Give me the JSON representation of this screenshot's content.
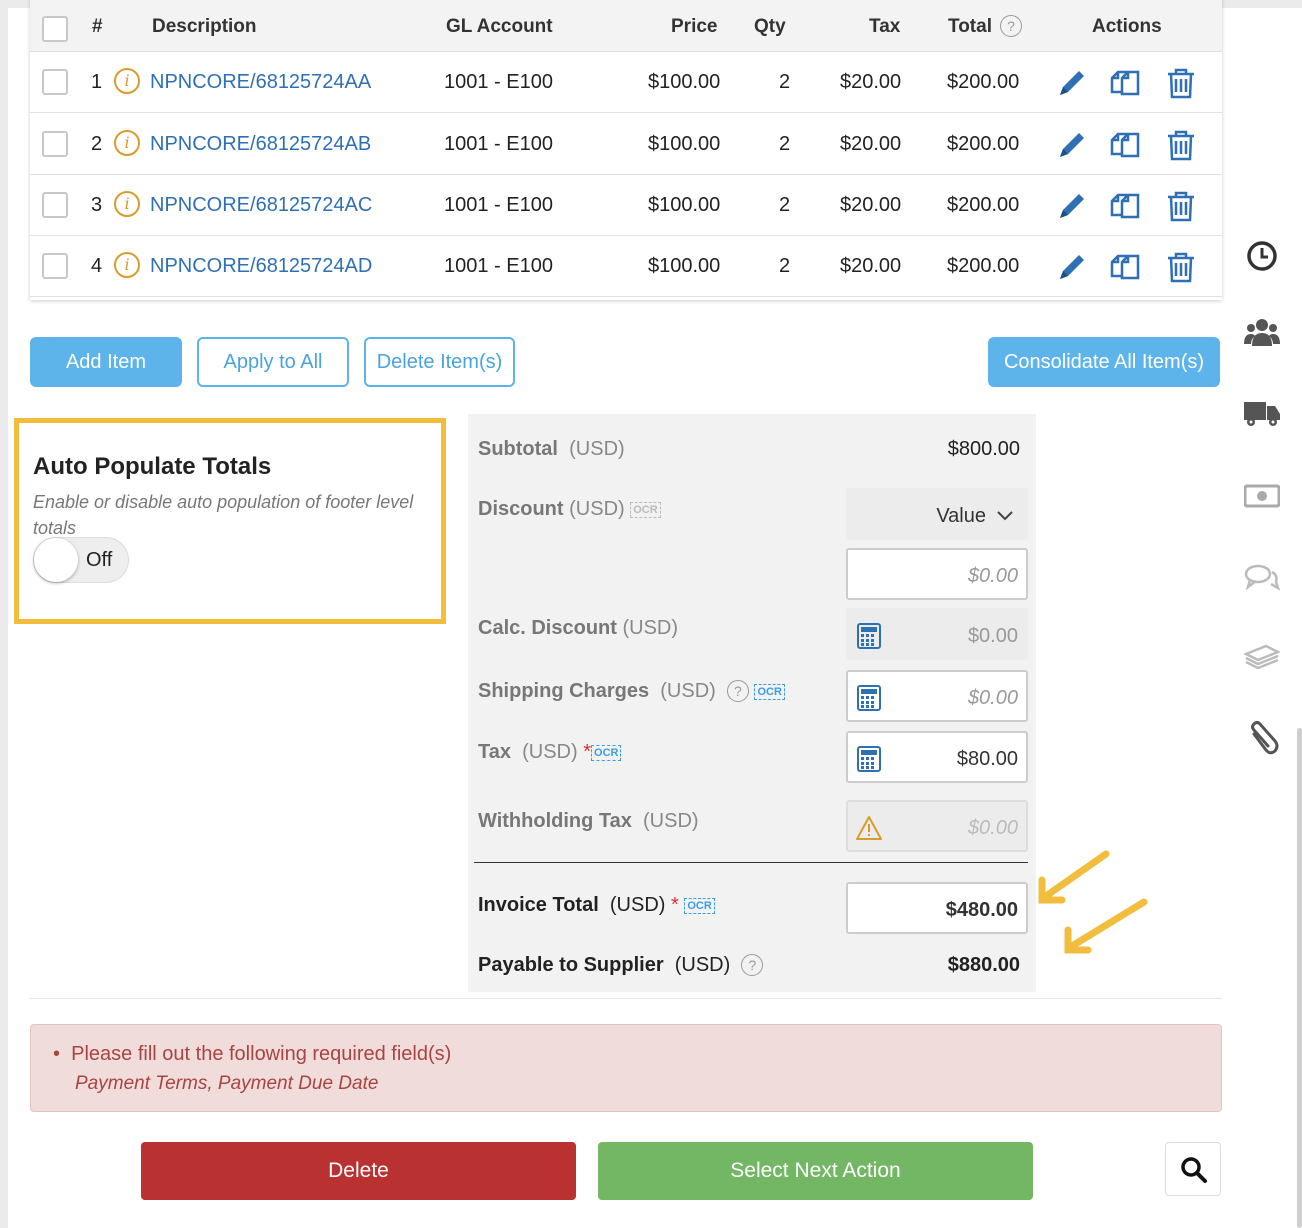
{
  "table": {
    "headers": {
      "num": "#",
      "description": "Description",
      "gl_account": "GL Account",
      "price": "Price",
      "qty": "Qty",
      "tax": "Tax",
      "total": "Total",
      "actions": "Actions"
    },
    "rows": [
      {
        "num": "1",
        "description": "NPNCORE/68125724AA",
        "gl": "1001 - E100",
        "price": "$100.00",
        "qty": "2",
        "tax": "$20.00",
        "total": "$200.00"
      },
      {
        "num": "2",
        "description": "NPNCORE/68125724AB",
        "gl": "1001 - E100",
        "price": "$100.00",
        "qty": "2",
        "tax": "$20.00",
        "total": "$200.00"
      },
      {
        "num": "3",
        "description": "NPNCORE/68125724AC",
        "gl": "1001 - E100",
        "price": "$100.00",
        "qty": "2",
        "tax": "$20.00",
        "total": "$200.00"
      },
      {
        "num": "4",
        "description": "NPNCORE/68125724AD",
        "gl": "1001 - E100",
        "price": "$100.00",
        "qty": "2",
        "tax": "$20.00",
        "total": "$200.00"
      }
    ]
  },
  "buttons": {
    "add_item": "Add Item",
    "apply_all": "Apply to All",
    "delete_items": "Delete Item(s)",
    "consolidate": "Consolidate All Item(s)"
  },
  "auto_populate": {
    "title": "Auto Populate Totals",
    "description": "Enable or disable auto population of footer level totals",
    "toggle_state": "Off"
  },
  "totals": {
    "subtotal_label": "Subtotal",
    "subtotal_unit": "(USD)",
    "subtotal_value": "$800.00",
    "discount_label": "Discount",
    "discount_unit": "(USD)",
    "discount_type": "Value",
    "discount_placeholder": "$0.00",
    "calc_discount_label": "Calc. Discount",
    "calc_discount_unit": "(USD)",
    "calc_discount_value": "$0.00",
    "shipping_label": "Shipping Charges",
    "shipping_unit": "(USD)",
    "shipping_placeholder": "$0.00",
    "tax_label": "Tax",
    "tax_unit": "(USD)",
    "tax_value": "$80.00",
    "withholding_label": "Withholding Tax",
    "withholding_unit": "(USD)",
    "withholding_placeholder": "$0.00",
    "invoice_total_label": "Invoice Total",
    "invoice_total_unit": "(USD)",
    "invoice_total_value": "$480.00",
    "payable_label": "Payable to Supplier",
    "payable_unit": "(USD)",
    "payable_value": "$880.00",
    "ocr_text": "OCR",
    "required_mark": "*",
    "help_mark": "?"
  },
  "alert": {
    "message": "Please fill out the following required field(s)",
    "fields": "Payment Terms, Payment Due Date"
  },
  "footer": {
    "delete": "Delete",
    "next_action": "Select Next Action"
  },
  "colors": {
    "primary": "#5db4ea",
    "danger": "#b93131",
    "success": "#73b765",
    "highlight": "#f2bd3d",
    "link": "#2f6fb3"
  }
}
